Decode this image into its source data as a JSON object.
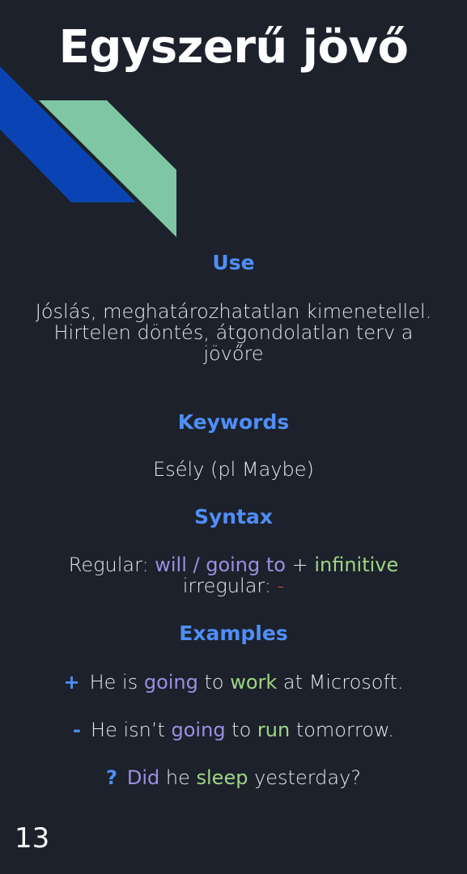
{
  "title": "Egyszerű jövő",
  "colors": {
    "background": "#1c212b",
    "heading": "#4f8ef7",
    "decor_blue": "#0a44b4",
    "decor_green": "#7fc6a4",
    "purple": "#9b8fe0",
    "green": "#9fd585",
    "red": "#e0533c"
  },
  "sections": {
    "use": {
      "heading": "Use",
      "line1": "Jóslás, meghatározhatatlan kimenetellel.",
      "line2": "Hirtelen döntés, átgondolatlan terv a jövőre"
    },
    "keywords": {
      "heading": "Keywords",
      "text": "Esély (pl Maybe)"
    },
    "syntax": {
      "heading": "Syntax",
      "regular_label": "Regular: ",
      "regular_aux": "will / going to",
      "plus": " + ",
      "regular_verb": "infinitive",
      "irregular_label": "irregular: ",
      "irregular_value": "-"
    },
    "examples": {
      "heading": "Examples",
      "items": [
        {
          "symbol": "+",
          "part1": "He is ",
          "aux": "going",
          "part2": " to ",
          "verb": "work",
          "part3": " at Microsoft."
        },
        {
          "symbol": "-",
          "part1": "He isn’t ",
          "aux": "going",
          "part2": " to ",
          "verb": "run",
          "part3": " tomorrow."
        },
        {
          "symbol": "?",
          "part1": "",
          "aux": "Did",
          "part2": " he ",
          "verb": "sleep",
          "part3": " yesterday?"
        }
      ]
    }
  },
  "page_number": "13"
}
